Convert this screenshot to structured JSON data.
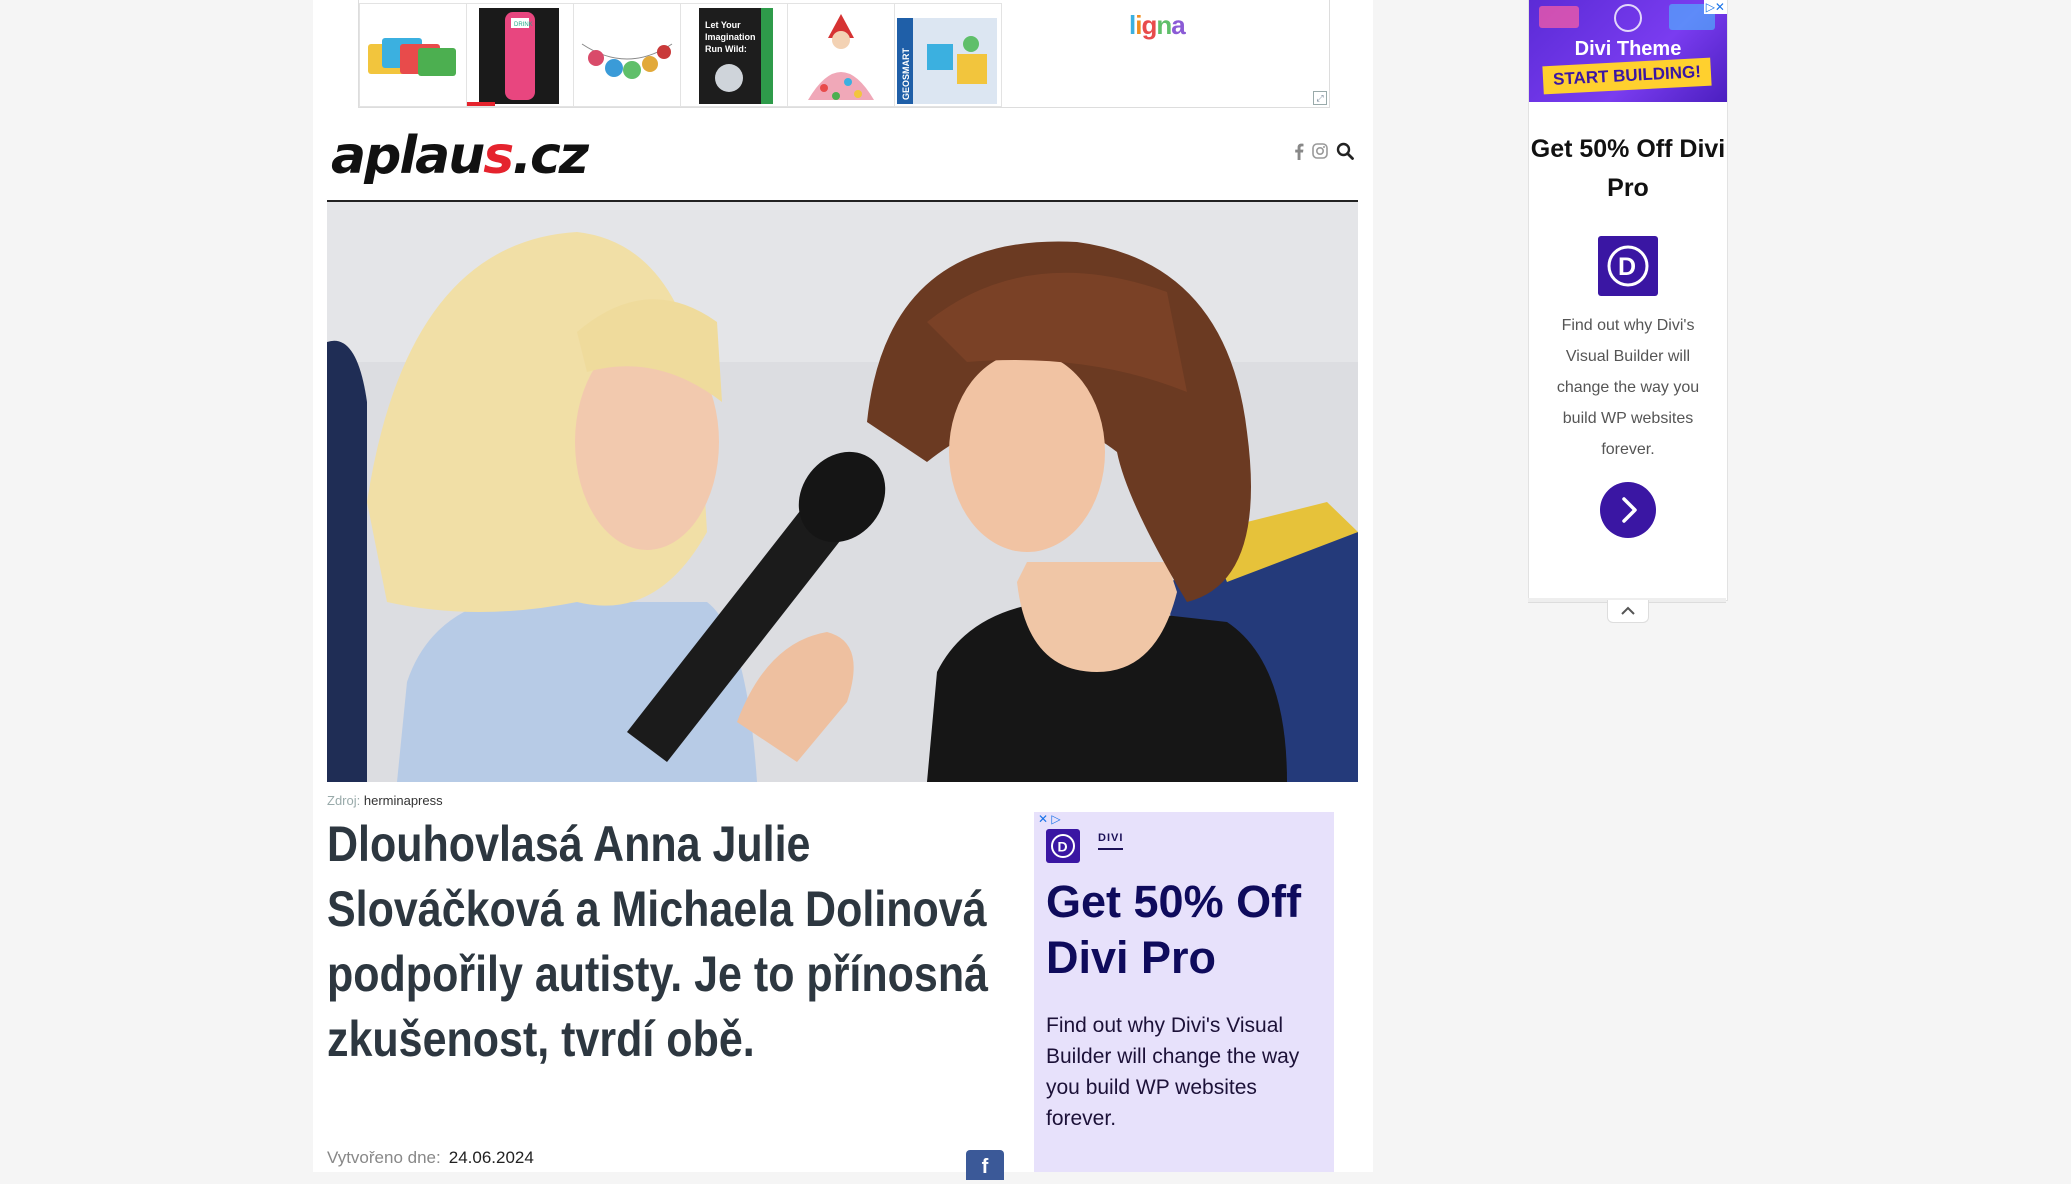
{
  "colors": {
    "brand_red": "#e5232d",
    "divi_purple": "#3a16a3",
    "headline": "#2d3740",
    "facebook": "#3b5998"
  },
  "top_ad": {
    "products": [
      {
        "icon": "baking-mats-icon"
      },
      {
        "icon": "water-bottle-icon",
        "label": "DRINK"
      },
      {
        "icon": "garland-icon"
      },
      {
        "icon": "book-icon",
        "label": "Let Your Imagination Run Wild:"
      },
      {
        "icon": "doll-icon"
      },
      {
        "icon": "magnetic-toy-box-icon",
        "label": "GEOSMART"
      }
    ],
    "brand": "ligna"
  },
  "header": {
    "logo_main": "aplau",
    "logo_accent": "s",
    "logo_suffix": ".cz",
    "icons": [
      "facebook-icon",
      "instagram-icon",
      "search-icon"
    ]
  },
  "article": {
    "credit_label": "Zdroj:",
    "credit_value": "herminapress",
    "headline": "Dlouhovlasá Anna Julie Slováčková a Michaela Dolinová podpořily autisty. Je to přínosná zkušenost, tvrdí obě.",
    "created_label": "Vytvořeno dne:",
    "created_date": "24.06.2024",
    "share_icon": "facebook-icon"
  },
  "inline_ad": {
    "brand": "DIVI",
    "title": "Get 50% Off Divi Pro",
    "body": "Find out why Divi's Visual Builder will change the way you build WP websites forever."
  },
  "side_ad": {
    "banner_title": "Divi Theme",
    "banner_cta": "START BUILDING!",
    "title": "Get 50% Off Divi Pro",
    "body": "Find out why Divi's Visual Builder will change the way you build WP websites forever.",
    "cta_icon": "chevron-right-icon",
    "collapse_icon": "chevron-up-icon"
  }
}
